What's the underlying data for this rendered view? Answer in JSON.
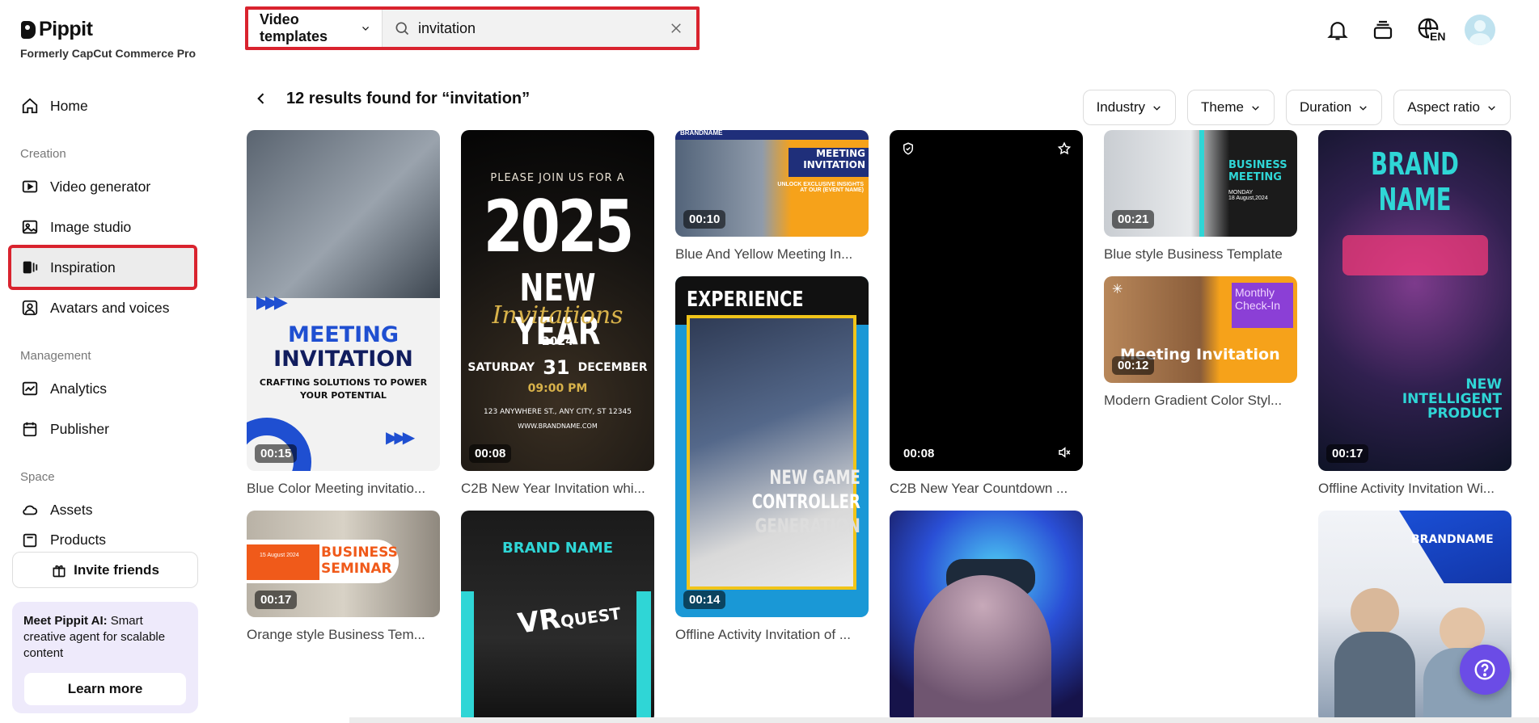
{
  "brand": {
    "name": "Pippit",
    "subtitle": "Formerly CapCut Commerce Pro"
  },
  "sidebar": {
    "home": "Home",
    "sections": {
      "creation": "Creation",
      "management": "Management",
      "space": "Space"
    },
    "creation": [
      "Video generator",
      "Image studio",
      "Inspiration",
      "Avatars and voices"
    ],
    "management": [
      "Analytics",
      "Publisher"
    ],
    "space": [
      "Assets",
      "Products"
    ],
    "invite": "Invite friends",
    "promo": {
      "bold": "Meet Pippit AI:",
      "text": " Smart creative agent for scalable content",
      "button": "Learn more"
    }
  },
  "search": {
    "type": "Video templates",
    "value": "invitation"
  },
  "topbar": {
    "language": "EN"
  },
  "results": {
    "title": "12 results found for “invitation”"
  },
  "filters": [
    "Industry",
    "Theme",
    "Duration",
    "Aspect ratio"
  ],
  "cards": [
    {
      "title": "Blue Color Meeting invitatio...",
      "duration": "00:15",
      "line1": "MEETING",
      "line2": "INVITATION",
      "line3": "CRAFTING SOLUTIONS TO POWER",
      "line4": "YOUR POTENTIAL"
    },
    {
      "title": "C2B New Year Invitation whi...",
      "duration": "00:08",
      "line1": "PLEASE JOIN US FOR A",
      "line2": "2025",
      "line3": "NEW YEAR",
      "line4": "Invitations",
      "line5": "2024",
      "line6": "SATURDAY",
      "line7": "31",
      "line8": "DECEMBER",
      "line9": "09:00 PM",
      "line10": "123 ANYWHERE ST., ANY CITY, ST 12345",
      "line11": "WWW.BRANDNAME.COM"
    },
    {
      "title": "Blue And Yellow Meeting In...",
      "duration": "00:10",
      "line1": "BRANDNAME",
      "line2": "MEETING",
      "line3": "INVITATION",
      "line4": "UNLOCK EXCLUSIVE INSIGHTS",
      "line5": "AT OUR (EVENT NAME)"
    },
    {
      "title": "C2B New Year Countdown ...",
      "duration": "00:08"
    },
    {
      "title": "Blue style Business Template",
      "duration": "00:21",
      "line1": "BUSINESS",
      "line2": "MEETING",
      "line3": "MONDAY",
      "line4": "18 August,2024"
    },
    {
      "title": "Offline Activity Invitation Wi...",
      "duration": "00:17",
      "line1": "BRAND NAME",
      "line2": "NEW",
      "line3": "INTELLIGENT",
      "line4": "PRODUCT"
    },
    {
      "title": "Offline Activity Invitation of ...",
      "duration": "00:14",
      "line1": "EXPERIENCE",
      "line2": "NEW GAME",
      "line3": "CONTROLLER",
      "line4": "GENERATION"
    },
    {
      "title": "Modern Gradient Color Styl...",
      "duration": "00:12",
      "line1": "Monthly",
      "line2": "Check-In",
      "line3": "Meeting Invitation"
    },
    {
      "title": "Orange style Business Tem...",
      "duration": "00:17",
      "line1": "BUSINESS",
      "line2": "SEMINAR",
      "line3": "15 August 2024"
    },
    {
      "title": "",
      "line1": "BRAND NAME",
      "line2": "VR",
      "line3": "QUEST"
    },
    {
      "title": ""
    },
    {
      "title": "",
      "line1": "BRANDNAME"
    }
  ],
  "colors": {
    "accent": "#d9232e",
    "help": "#6b4ce6",
    "promo_bg": "#eeeafb"
  }
}
